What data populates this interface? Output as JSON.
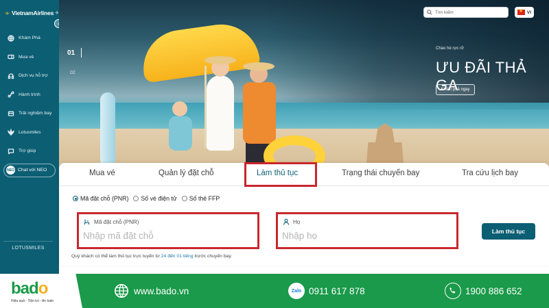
{
  "sidebar": {
    "brand": "VietnamAirlines",
    "items": [
      {
        "label": "Khám Phá",
        "icon": "globe-icon"
      },
      {
        "label": "Mua vé",
        "icon": "ticket-icon"
      },
      {
        "label": "Dịch vụ hỗ trợ",
        "icon": "support-icon"
      },
      {
        "label": "Hành trình",
        "icon": "route-icon"
      },
      {
        "label": "Trải nghiệm bay",
        "icon": "plane-icon"
      },
      {
        "label": "Lotusmiles",
        "icon": "lotus-icon"
      },
      {
        "label": "Trợ giúp",
        "icon": "help-icon"
      }
    ],
    "chat": {
      "label": "Chat với NEO",
      "badge": "NEO"
    },
    "lotusmiles_banner": "LOTUSMILES"
  },
  "hero": {
    "slide_current": "01",
    "slide_next": "02",
    "search_placeholder": "Tìm kiếm",
    "lang": "VI",
    "promo_sub": "Chào hè rực rỡ",
    "promo_title": "ƯU ĐÃI THẢ GA",
    "promo_button": "Khám phá ngay"
  },
  "tabs": [
    {
      "label": "Mua vé"
    },
    {
      "label": "Quản lý đặt chỗ"
    },
    {
      "label": "Làm thủ tục",
      "active": true
    },
    {
      "label": "Trạng thái chuyến bay"
    },
    {
      "label": "Tra cứu lịch bay"
    }
  ],
  "checkin": {
    "options": [
      {
        "label": "Mã đặt chỗ (PNR)",
        "selected": true
      },
      {
        "label": "Số vé điện tử",
        "selected": false
      },
      {
        "label": "Số thẻ FFP",
        "selected": false
      }
    ],
    "pnr_label": "Mã đặt chỗ (PNR)",
    "pnr_placeholder": "Nhập mã đặt chỗ",
    "name_label": "Họ",
    "name_placeholder": "Nhập họ",
    "button": "Làm thủ tục",
    "note_before": "Quý khách có thể làm thủ tục trực tuyến từ ",
    "note_highlight": "24 đến 01 tiếng",
    "note_after": " trước chuyến bay."
  },
  "footer": {
    "logo": {
      "b": "b",
      "a": "a",
      "d": "d",
      "o": "o"
    },
    "slogan": "Hiệu quả - Tiện lợi - An toàn",
    "website": "www.bado.vn",
    "zalo_icon_text": "Zalo",
    "zalo_phone": "0911 617 878",
    "hotline": "1900 886 652"
  },
  "colors": {
    "brand": "#0c5e73",
    "highlight": "#c8262c",
    "footer": "#1a9a4a"
  }
}
